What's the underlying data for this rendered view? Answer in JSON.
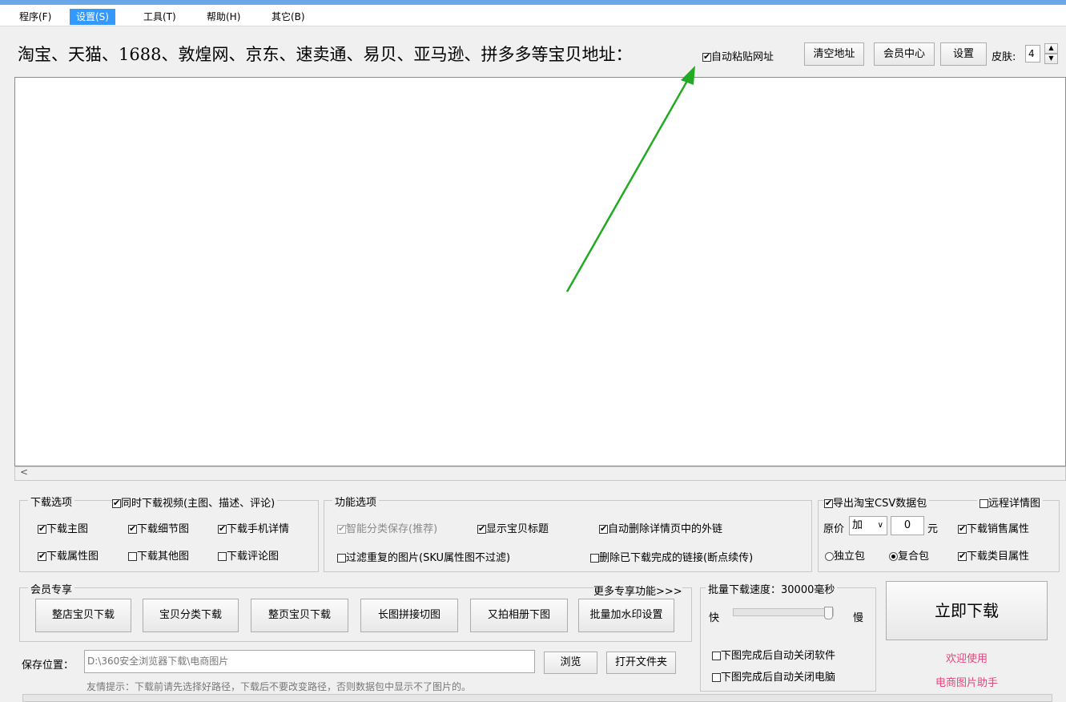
{
  "menu": [
    {
      "label": "程序(F)"
    },
    {
      "label": "设置(S)"
    },
    {
      "label": "工具(T)"
    },
    {
      "label": "帮助(H)"
    },
    {
      "label": "其它(B)"
    }
  ],
  "header": {
    "sites_label": "淘宝、天猫、1688、敦煌网、京东、速卖通、易贝、亚马逊、拼多多等宝贝地址：",
    "auto_paste_label": "自动粘贴网址",
    "auto_paste_checked": true,
    "clear_btn": "清空地址",
    "member_btn": "会员中心",
    "settings_btn": "设置",
    "skin_label": "皮肤:",
    "skin_value": "4"
  },
  "scroll_left": "<",
  "download_options": {
    "title": "下载选项",
    "video_label": "同时下载视频(主图、描述、评论)",
    "main_img": "下载主图",
    "detail_img": "下载细节图",
    "mobile_detail": "下载手机详情",
    "attr_img": "下载属性图",
    "other_img": "下载其他图",
    "comment_img": "下载评论图"
  },
  "function_options": {
    "title": "功能选项",
    "smart_save": "智能分类保存(推荐)",
    "show_title": "显示宝贝标题",
    "auto_delete_links": "自动删除详情页中的外链",
    "filter_dup": "过滤重复的图片(SKU属性图不过滤)",
    "delete_done": "删除已下载完成的链接(断点续传)"
  },
  "export": {
    "export_csv": "导出淘宝CSV数据包",
    "remote_detail": "远程详情图",
    "price_label": "原价",
    "price_op": "加",
    "price_value": "0",
    "price_unit": "元",
    "sales_attr": "下载销售属性",
    "standalone": "独立包",
    "composite": "复合包",
    "category_attr": "下载类目属性"
  },
  "member": {
    "title": "会员专享",
    "more_link": "更多专享功能>>>",
    "buttons": [
      "整店宝贝下载",
      "宝贝分类下载",
      "整页宝贝下载",
      "长图拼接切图",
      "又拍相册下图",
      "批量加水印设置"
    ]
  },
  "speed": {
    "title": "批量下载速度：30000毫秒",
    "fast": "快",
    "slow": "慢",
    "level_fraction": 1.0,
    "close_app": "下图完成后自动关闭软件",
    "shutdown": "下图完成后自动关闭电脑"
  },
  "download_btn": "立即下载",
  "welcome": {
    "line1": "欢迎使用",
    "line2": "电商图片助手"
  },
  "save": {
    "label": "保存位置：",
    "path": "D:\\360安全浏览器下载\\电商图片",
    "browse_btn": "浏览",
    "open_folder_btn": "打开文件夹",
    "tip": "友情提示：下载前请先选择好路径，下载后不要改变路径，否则数据包中显示不了图片的。"
  },
  "colors": {
    "menu_active": "#3399ff",
    "annotation_arrow": "#22aa22",
    "welcome_text": "#e8457b"
  }
}
